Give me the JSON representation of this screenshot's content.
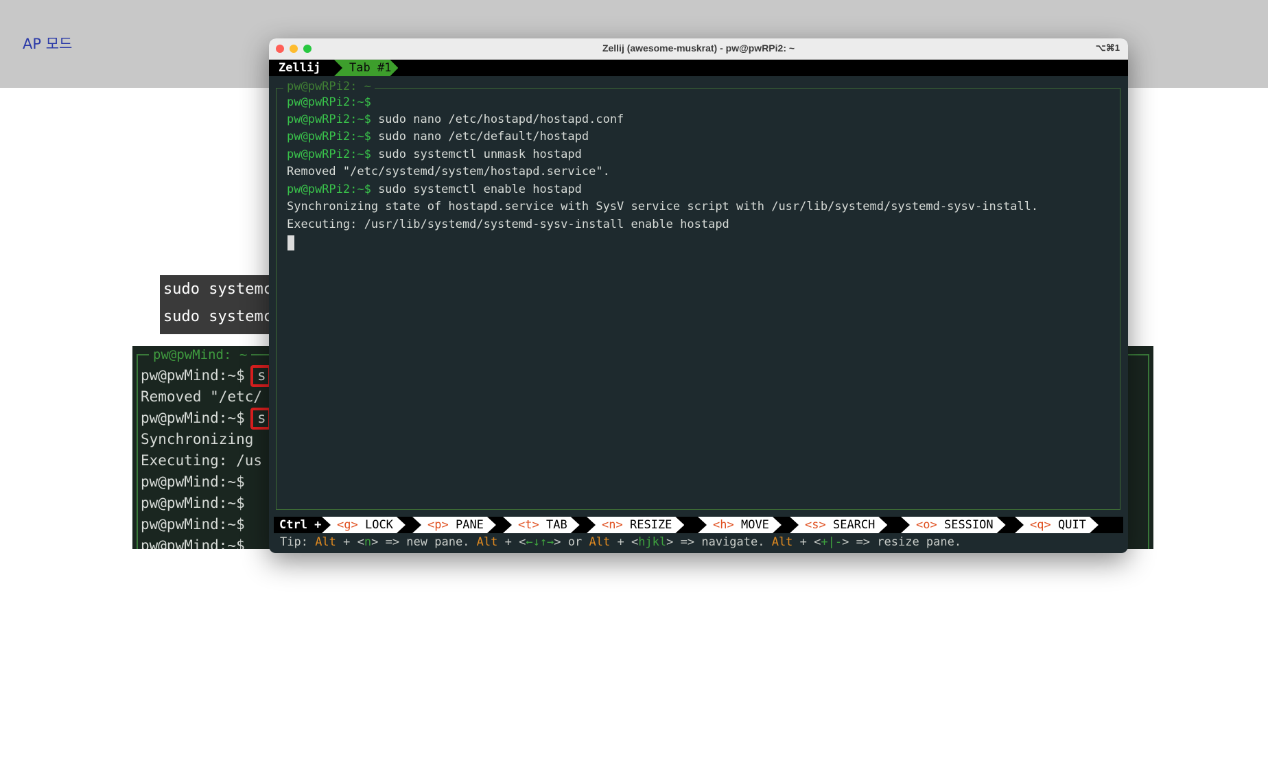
{
  "slide": {
    "title": "AP 모드",
    "code_snippet": [
      "sudo systemc",
      "sudo systemc"
    ]
  },
  "bg_terminal": {
    "frame_title": "pw@pwMind: ~",
    "lines": [
      "pw@pwMind:~$",
      "Removed \"/etc/",
      "pw@pwMind:~$",
      "Synchronizing",
      "Executing: /us",
      "pw@pwMind:~$",
      "pw@pwMind:~$",
      "pw@pwMind:~$",
      "pw@pwMind:~$"
    ],
    "highlight_char": "s"
  },
  "window": {
    "title": "Zellij (awesome-muskrat) - pw@pwRPi2: ~",
    "shortcut": "⌥⌘1",
    "app_name": "Zellij",
    "tab_label": "Tab #1",
    "pane_title": "pw@pwRPi2: ~",
    "prompt": "pw@pwRPi2:~$",
    "lines": [
      {
        "prompt": "pw@pwRPi2:~$",
        "text": ""
      },
      {
        "prompt": "pw@pwRPi2:~$",
        "text": " sudo nano /etc/hostapd/hostapd.conf"
      },
      {
        "prompt": "pw@pwRPi2:~$",
        "text": " sudo nano /etc/default/hostapd"
      },
      {
        "prompt": "pw@pwRPi2:~$",
        "text": " sudo systemctl unmask hostapd"
      },
      {
        "prompt": "",
        "text": "Removed \"/etc/systemd/system/hostapd.service\"."
      },
      {
        "prompt": "pw@pwRPi2:~$",
        "text": " sudo systemctl enable hostapd"
      },
      {
        "prompt": "",
        "text": "Synchronizing state of hostapd.service with SysV service script with /usr/lib/systemd/systemd-sysv-install."
      },
      {
        "prompt": "",
        "text": "Executing: /usr/lib/systemd/systemd-sysv-install enable hostapd"
      }
    ]
  },
  "statusbar": {
    "ctrl_label": "Ctrl +",
    "items": [
      {
        "key": "<g>",
        "label": "LOCK"
      },
      {
        "key": "<p>",
        "label": "PANE"
      },
      {
        "key": "<t>",
        "label": "TAB"
      },
      {
        "key": "<n>",
        "label": "RESIZE"
      },
      {
        "key": "<h>",
        "label": "MOVE"
      },
      {
        "key": "<s>",
        "label": "SEARCH"
      },
      {
        "key": "<o>",
        "label": "SESSION"
      },
      {
        "key": "<q>",
        "label": "QUIT"
      }
    ]
  },
  "tip": {
    "prefix": "Tip: ",
    "alt": "Alt",
    "part1_key": "n",
    "part1_text": "new pane.",
    "part2_key": "←↓↑→",
    "part2_or": "or",
    "part2_key2": "hjkl",
    "part2_text": "navigate.",
    "part3_key": "+|-",
    "part3_text": "resize pane."
  },
  "colors": {
    "prompt_green": "#39c24a",
    "tab_green": "#3d9e2c",
    "tip_orange": "#e08a20",
    "terminal_bg": "#1e2a2e"
  }
}
